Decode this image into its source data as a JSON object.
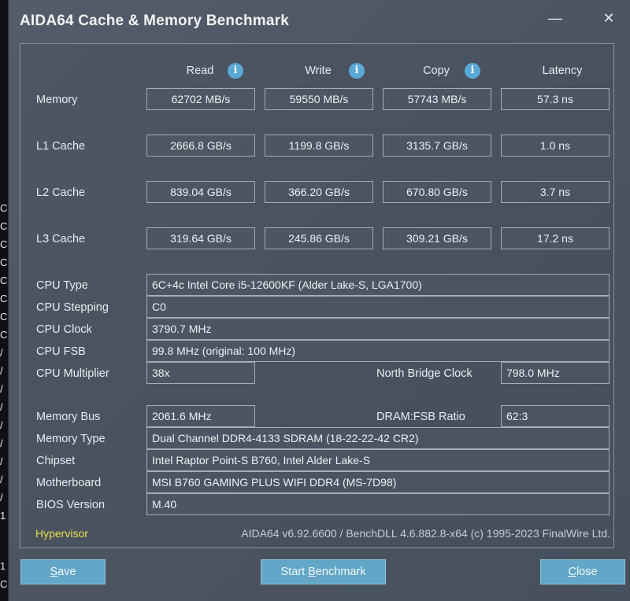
{
  "background_glyphs": [
    "C",
    "C",
    "C",
    "C",
    "C",
    "C",
    "C",
    "C",
    "/",
    "/",
    "/",
    "/",
    "/",
    "/",
    "/",
    "/",
    "/",
    "1",
    "1",
    "C"
  ],
  "window": {
    "title": "AIDA64 Cache & Memory Benchmark",
    "minimize_glyph": "—",
    "close_glyph": "✕"
  },
  "columns": {
    "read": "Read",
    "write": "Write",
    "copy": "Copy",
    "latency": "Latency",
    "info_glyph": "i"
  },
  "rows": [
    {
      "label": "Memory",
      "read": "62702 MB/s",
      "write": "59550 MB/s",
      "copy": "57743 MB/s",
      "latency": "57.3 ns"
    },
    {
      "label": "L1 Cache",
      "read": "2666.8 GB/s",
      "write": "1199.8 GB/s",
      "copy": "3135.7 GB/s",
      "latency": "1.0 ns"
    },
    {
      "label": "L2 Cache",
      "read": "839.04 GB/s",
      "write": "366.20 GB/s",
      "copy": "670.80 GB/s",
      "latency": "3.7 ns"
    },
    {
      "label": "L3 Cache",
      "read": "319.64 GB/s",
      "write": "245.86 GB/s",
      "copy": "309.21 GB/s",
      "latency": "17.2 ns"
    }
  ],
  "cpu": {
    "type_label": "CPU Type",
    "type_value": "6C+4c Intel Core i5-12600KF  (Alder Lake-S, LGA1700)",
    "stepping_label": "CPU Stepping",
    "stepping_value": "C0",
    "clock_label": "CPU Clock",
    "clock_value": "3790.7 MHz",
    "fsb_label": "CPU FSB",
    "fsb_value": "99.8 MHz  (original: 100 MHz)",
    "multiplier_label": "CPU Multiplier",
    "multiplier_value": "38x",
    "nb_clock_label": "North Bridge Clock",
    "nb_clock_value": "798.0 MHz"
  },
  "memory": {
    "bus_label": "Memory Bus",
    "bus_value": "2061.6 MHz",
    "ratio_label": "DRAM:FSB Ratio",
    "ratio_value": "62:3",
    "type_label": "Memory Type",
    "type_value": "Dual Channel DDR4-4133 SDRAM  (18-22-22-42 CR2)",
    "chipset_label": "Chipset",
    "chipset_value": "Intel Raptor Point-S B760, Intel Alder Lake-S",
    "motherboard_label": "Motherboard",
    "motherboard_value": "MSI B760 GAMING PLUS WIFI DDR4 (MS-7D98)",
    "bios_label": "BIOS Version",
    "bios_value": "M.40"
  },
  "status": {
    "hypervisor": "Hypervisor",
    "version": "AIDA64 v6.92.6600 / BenchDLL 4.6.882.8-x64  (c) 1995-2023 FinalWire Ltd."
  },
  "buttons": {
    "save_mnemonic": "S",
    "save_rest": "ave",
    "start_prefix": "Start ",
    "start_mnemonic": "B",
    "start_rest": "enchmark",
    "close_mnemonic": "C",
    "close_rest": "lose"
  },
  "colors": {
    "window_bg": "#4e5664",
    "accent_button": "#62a7c7",
    "info_icon": "#5aa8d6",
    "hypervisor_text": "#e6e04a"
  }
}
